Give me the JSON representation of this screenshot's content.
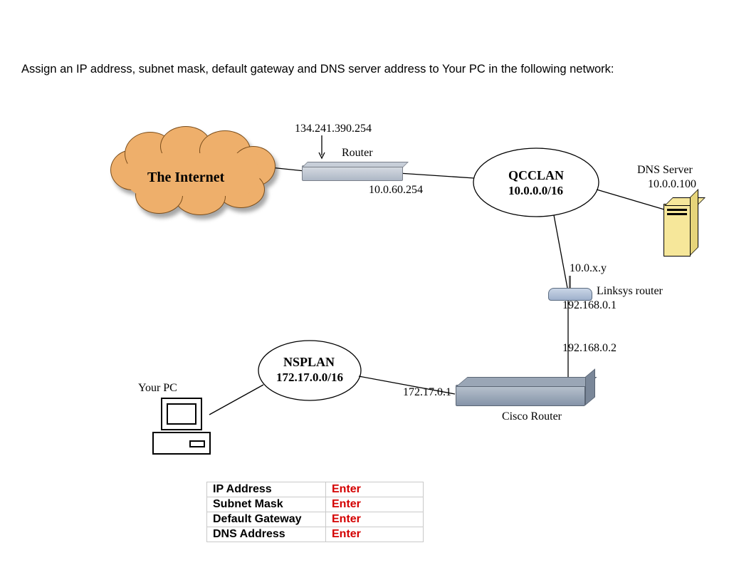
{
  "instruction": "Assign an IP address, subnet mask, default gateway and DNS server address to Your PC in the following network:",
  "internet": {
    "label": "The Internet"
  },
  "router": {
    "label": "Router",
    "ip_external": "134.241.390.254",
    "ip_internal": "10.0.60.254"
  },
  "qcclan": {
    "name": "QCCLAN",
    "cidr": "10.0.0.0/16"
  },
  "dns_server": {
    "label": "DNS Server",
    "ip": "10.0.0.100"
  },
  "linksys": {
    "label": "Linksys router",
    "ip_wan": "10.0.x.y",
    "ip_lan": "192.168.0.1"
  },
  "cisco": {
    "label": "Cisco Router",
    "ip_wan": "192.168.0.2",
    "ip_lan": "172.17.0.1"
  },
  "nsplan": {
    "name": "NSPLAN",
    "cidr": "172.17.0.0/16"
  },
  "your_pc": {
    "label": "Your PC"
  },
  "table": {
    "rows": [
      {
        "label": "IP Address",
        "value": "Enter"
      },
      {
        "label": "Subnet Mask",
        "value": "Enter"
      },
      {
        "label": "Default Gateway",
        "value": "Enter"
      },
      {
        "label": "DNS Address",
        "value": "Enter"
      }
    ]
  }
}
